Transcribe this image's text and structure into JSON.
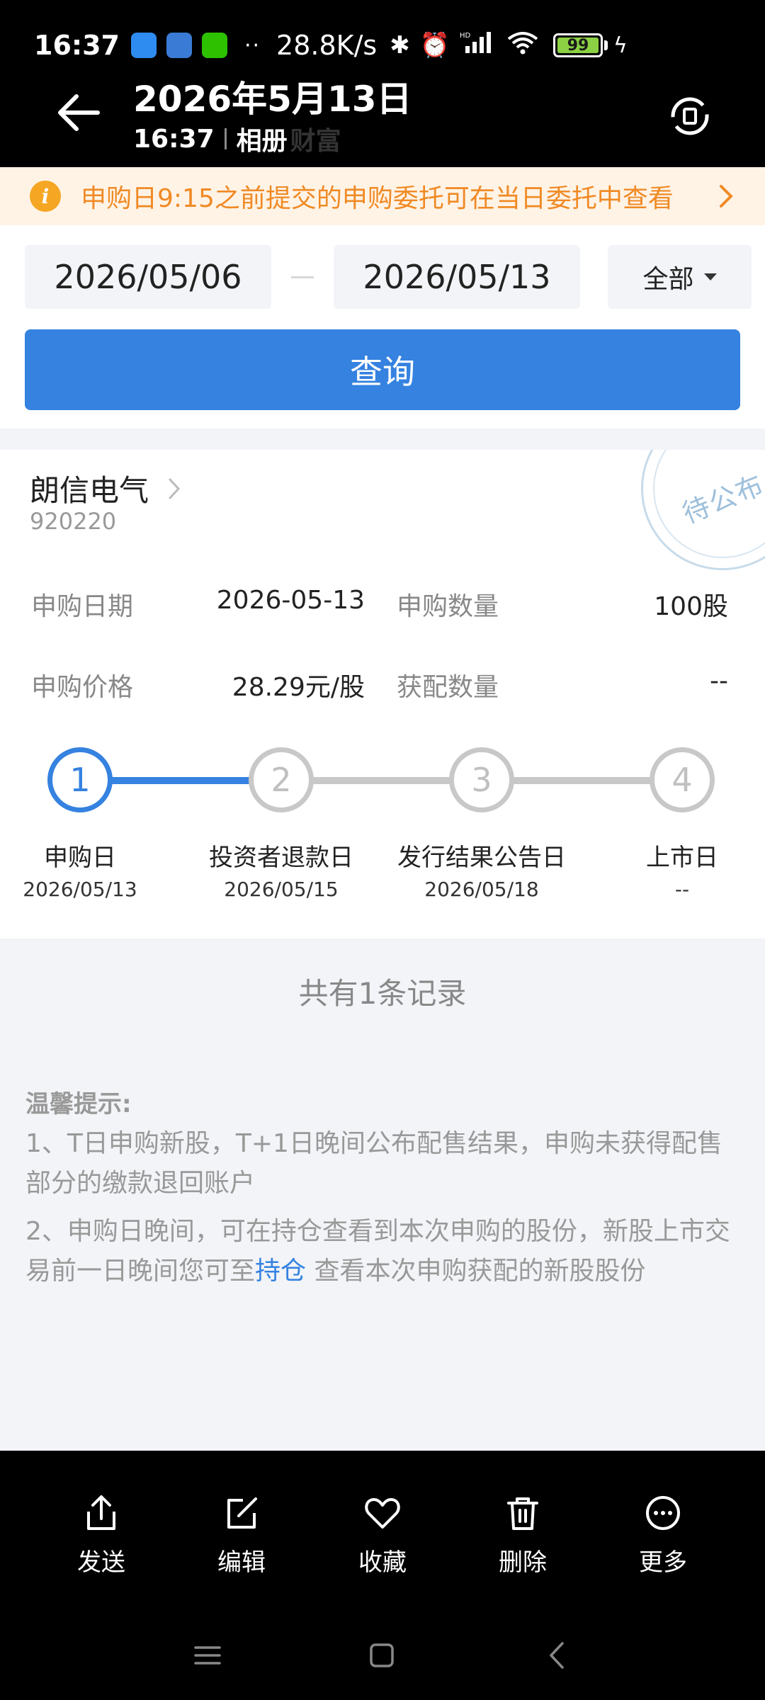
{
  "status_bar": {
    "time": "16:37",
    "dots": "··",
    "net_speed": "28.8K/s",
    "battery": "99"
  },
  "viewer": {
    "title": "2026年5月13日",
    "time": "16:37",
    "album": "相册",
    "faded_text": "财富"
  },
  "notice": {
    "icon": "i",
    "text": "申购日9:15之前提交的申购委托可在当日委托中查看"
  },
  "search": {
    "start_date": "2026/05/06",
    "end_date": "2026/05/13",
    "filter": "全部",
    "query_label": "查询"
  },
  "record": {
    "name": "朗信电气",
    "code": "920220",
    "stamp": "待公布",
    "apply_date_label": "申购日期",
    "apply_date": "2026-05-13",
    "apply_qty_label": "申购数量",
    "apply_qty": "100股",
    "price_label": "申购价格",
    "price": "28.29元/股",
    "allot_label": "获配数量",
    "allot": "--",
    "current_step": 1,
    "steps": [
      {
        "num": "1",
        "label": "申购日",
        "date": "2026/05/13"
      },
      {
        "num": "2",
        "label": "投资者退款日",
        "date": "2026/05/15"
      },
      {
        "num": "3",
        "label": "发行结果公告日",
        "date": "2026/05/18"
      },
      {
        "num": "4",
        "label": "上市日",
        "date": "--"
      }
    ]
  },
  "summary": "共有1条记录",
  "tips": {
    "title": "温馨提示:",
    "line1": "1、T日申购新股，T+1日晚间公布配售结果，申购未获得配售部分的缴款退回账户",
    "line2_a": "2、申购日晚间，可在持仓查看到本次申购的股份，新股上市交易前一日晚间您可至",
    "line2_link": "持仓",
    "line2_b": " 查看本次申购获配的新股股份"
  },
  "toolbar": {
    "send": "发送",
    "edit": "编辑",
    "favorite": "收藏",
    "delete": "删除",
    "more": "更多"
  },
  "colors": {
    "accent": "#3582e0",
    "notice_bg": "#fff3e6",
    "notice_text": "#f08a24",
    "battery": "#8bd143"
  }
}
